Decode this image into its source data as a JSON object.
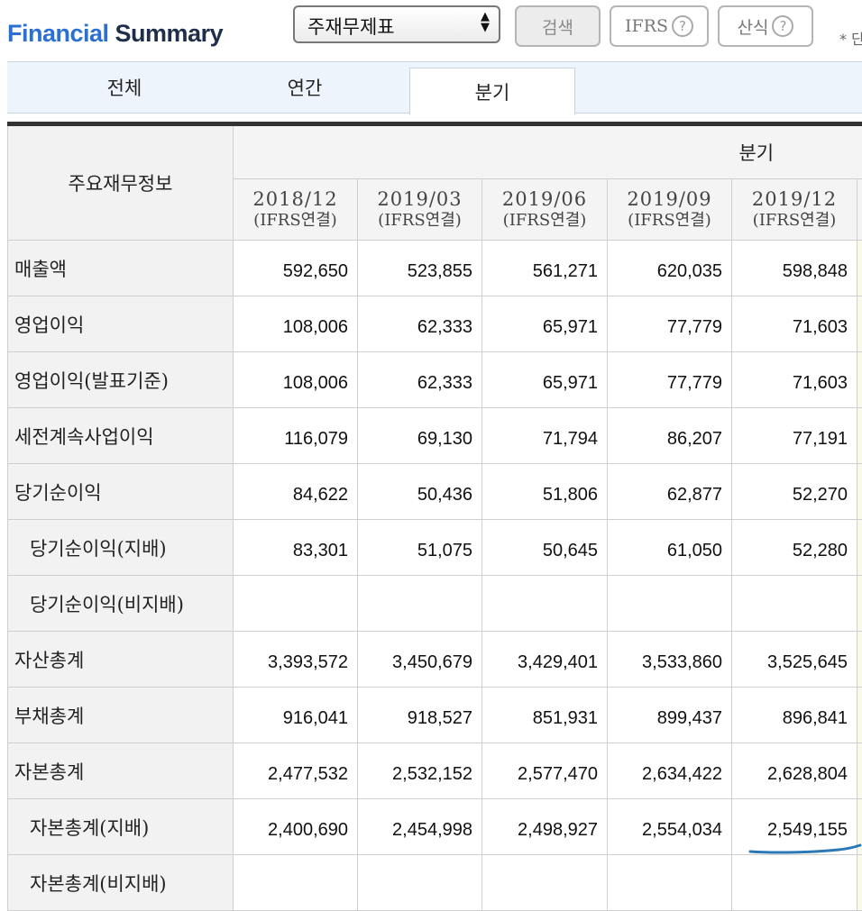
{
  "header": {
    "title_part1": "Financial",
    "title_part2": "Summary",
    "statement_select": "주재무제표",
    "search_label": "검색",
    "ifrs_label": "IFRS",
    "calc_label": "산식",
    "help_symbol": "?",
    "note": "* 단"
  },
  "tabs": [
    {
      "label": "전체"
    },
    {
      "label": "연간"
    },
    {
      "label": "분기"
    }
  ],
  "table": {
    "corner_label": "주요재무정보",
    "group_label": "분기",
    "periods": [
      {
        "date": "2018/12",
        "basis": "(IFRS연결)"
      },
      {
        "date": "2019/03",
        "basis": "(IFRS연결)"
      },
      {
        "date": "2019/06",
        "basis": "(IFRS연결)"
      },
      {
        "date": "2019/09",
        "basis": "(IFRS연결)"
      },
      {
        "date": "2019/12",
        "basis": "(IFRS연결)"
      }
    ],
    "rows": [
      {
        "label": "매출액",
        "values": [
          "592,650",
          "523,855",
          "561,271",
          "620,035",
          "598,848"
        ]
      },
      {
        "label": "영업이익",
        "values": [
          "108,006",
          "62,333",
          "65,971",
          "77,779",
          "71,603"
        ]
      },
      {
        "label": "영업이익(발표기준)",
        "values": [
          "108,006",
          "62,333",
          "65,971",
          "77,779",
          "71,603"
        ]
      },
      {
        "label": "세전계속사업이익",
        "values": [
          "116,079",
          "69,130",
          "71,794",
          "86,207",
          "77,191"
        ]
      },
      {
        "label": "당기순이익",
        "values": [
          "84,622",
          "50,436",
          "51,806",
          "62,877",
          "52,270"
        ]
      },
      {
        "label": "당기순이익(지배)",
        "values": [
          "83,301",
          "51,075",
          "50,645",
          "61,050",
          "52,280"
        ]
      },
      {
        "label": "당기순이익(비지배)",
        "values": [
          "",
          "",
          "",
          "",
          ""
        ]
      },
      {
        "label": "자산총계",
        "values": [
          "3,393,572",
          "3,450,679",
          "3,429,401",
          "3,533,860",
          "3,525,645"
        ]
      },
      {
        "label": "부채총계",
        "values": [
          "916,041",
          "918,527",
          "851,931",
          "899,437",
          "896,841"
        ]
      },
      {
        "label": "자본총계",
        "values": [
          "2,477,532",
          "2,532,152",
          "2,577,470",
          "2,634,422",
          "2,628,804"
        ]
      },
      {
        "label": "자본총계(지배)",
        "values": [
          "2,400,690",
          "2,454,998",
          "2,498,927",
          "2,554,034",
          "2,549,155"
        ]
      },
      {
        "label": "자본총계(비지배)",
        "values": [
          "",
          "",
          "",
          "",
          ""
        ]
      }
    ]
  },
  "colors": {
    "title_blue": "#2b6fd3",
    "title_dark": "#1f2f4a",
    "highlight_stroke": "#2a79b6"
  }
}
